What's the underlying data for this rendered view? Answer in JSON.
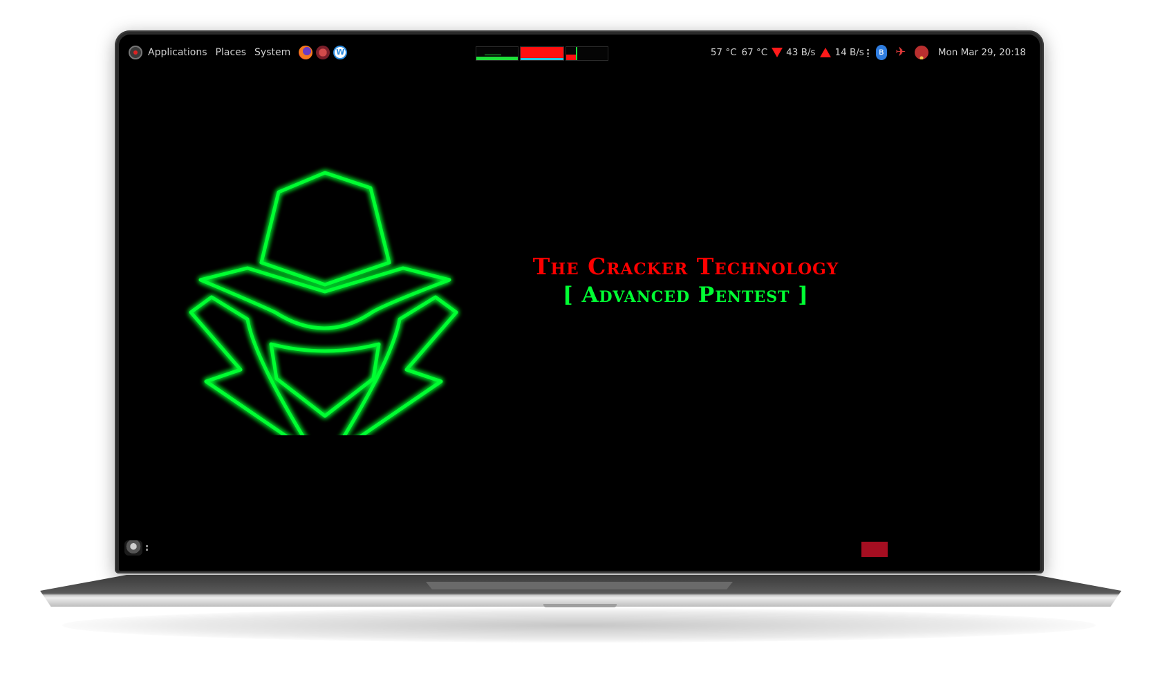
{
  "panel": {
    "menu": [
      "Applications",
      "Places",
      "System"
    ],
    "launchers": [
      "firefox-icon",
      "burpsuite-icon",
      "writer-icon"
    ],
    "writer_glyph": "W",
    "tray": {
      "temp_cpu": "57 °C",
      "temp_gpu": "67 °C",
      "net_down": "43 B/s",
      "net_up": "14 B/s",
      "icons": [
        "bluetooth-icon",
        "network-icon",
        "wifi-icon"
      ],
      "bt_glyph": "ʙ",
      "net_glyph": "✈",
      "clock": "Mon Mar 29, 20:18"
    }
  },
  "desktop": {
    "title": "The Cracker Technology",
    "subtitle": "[ Advanced Pentest ]"
  },
  "colors": {
    "emblem": "#00ff33",
    "title": "#ff0000",
    "subtitle": "#00ff33",
    "accent_red": "#ff1a1a",
    "workspace": "#a50e21"
  }
}
